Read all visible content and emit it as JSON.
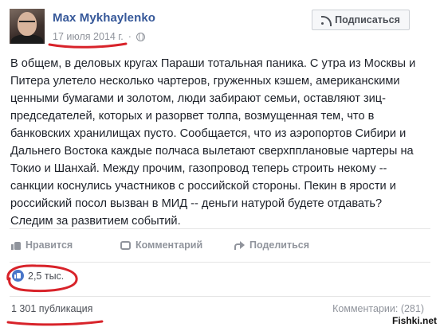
{
  "post": {
    "author": "Max Mykhaylenko",
    "date": "17 июля 2014 г.",
    "meta_separator": "·",
    "privacy_icon": "globe-icon",
    "subscribe_label": "Подписаться",
    "subscribe_icon": "rss-icon",
    "text": "В общем, в деловых кругах Параши тотальная паника. С утра из Москвы и Питера улетело несколько чартеров, груженных кэшем, американскими ценными бумагами и золотом, люди забирают семьи, оставляют зиц-председателей, которых и разорвет толпа, возмущенная тем, что в банковских хранилищах пусто. Сообщается, что из аэропортов Сибири и Дальнего Востока каждые полчаса вылетают сверхпплановые чартеры на Токио и Шанхай. Между прочим, газопровод теперь строить некому -- санкции коснулись участников с российской стороны. Пекин в ярости и российский посол вызван в МИД -- деньги натурой будете отдавать? Следим за развитием событий."
  },
  "actions": {
    "like_label": "Нравится",
    "comment_label": "Комментарий",
    "share_label": "Поделиться"
  },
  "stats": {
    "reactions_count": "2,5 тыс.",
    "publications": "1 301 публикация",
    "comments": "Комментарии: (281)"
  },
  "watermark": "Fishki.net",
  "colors": {
    "link_blue": "#365899",
    "muted_gray": "#90949c",
    "annotation_red": "#d8232a",
    "like_badge_blue": "#4a76c9"
  }
}
